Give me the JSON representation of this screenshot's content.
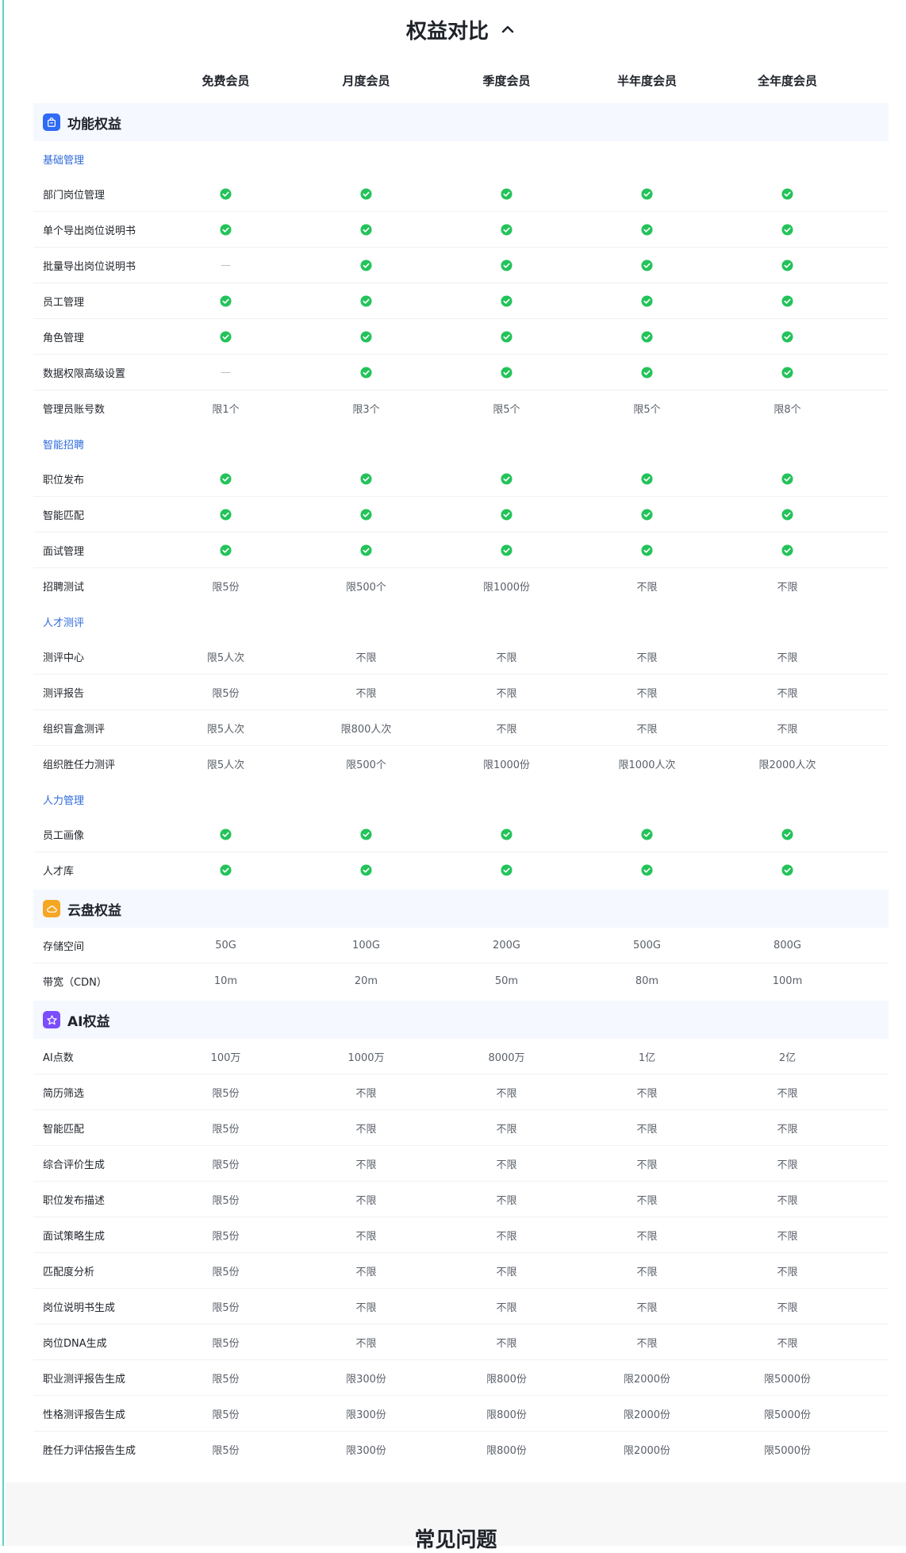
{
  "title": "权益对比",
  "columns": [
    "免费会员",
    "月度会员",
    "季度会员",
    "半年度会员",
    "全年度会员"
  ],
  "colors": {
    "check": "#23c35a",
    "subcat": "#2f6bdc",
    "section_bg": "#f5f8ff"
  },
  "sections": [
    {
      "title": "功能权益",
      "icon": "bag-icon",
      "icon_color": "#2f6bf5",
      "groups": [
        {
          "name": "基础管理",
          "rows": [
            {
              "label": "部门岗位管理",
              "values": [
                "check",
                "check",
                "check",
                "check",
                "check"
              ]
            },
            {
              "label": "单个导出岗位说明书",
              "values": [
                "check",
                "check",
                "check",
                "check",
                "check"
              ]
            },
            {
              "label": "批量导出岗位说明书",
              "values": [
                "dash",
                "check",
                "check",
                "check",
                "check"
              ]
            },
            {
              "label": "员工管理",
              "values": [
                "check",
                "check",
                "check",
                "check",
                "check"
              ]
            },
            {
              "label": "角色管理",
              "values": [
                "check",
                "check",
                "check",
                "check",
                "check"
              ]
            },
            {
              "label": "数据权限高级设置",
              "values": [
                "dash",
                "check",
                "check",
                "check",
                "check"
              ]
            },
            {
              "label": "管理员账号数",
              "values": [
                "限1个",
                "限3个",
                "限5个",
                "限5个",
                "限8个"
              ]
            }
          ]
        },
        {
          "name": "智能招聘",
          "rows": [
            {
              "label": "职位发布",
              "values": [
                "check",
                "check",
                "check",
                "check",
                "check"
              ]
            },
            {
              "label": "智能匹配",
              "values": [
                "check",
                "check",
                "check",
                "check",
                "check"
              ]
            },
            {
              "label": "面试管理",
              "values": [
                "check",
                "check",
                "check",
                "check",
                "check"
              ]
            },
            {
              "label": "招聘测试",
              "values": [
                "限5份",
                "限500个",
                "限1000份",
                "不限",
                "不限"
              ]
            }
          ]
        },
        {
          "name": "人才测评",
          "rows": [
            {
              "label": "测评中心",
              "values": [
                "限5人次",
                "不限",
                "不限",
                "不限",
                "不限"
              ]
            },
            {
              "label": "测评报告",
              "values": [
                "限5份",
                "不限",
                "不限",
                "不限",
                "不限"
              ]
            },
            {
              "label": "组织盲盒测评",
              "values": [
                "限5人次",
                "限800人次",
                "不限",
                "不限",
                "不限"
              ]
            },
            {
              "label": "组织胜任力测评",
              "values": [
                "限5人次",
                "限500个",
                "限1000份",
                "限1000人次",
                "限2000人次"
              ]
            }
          ]
        },
        {
          "name": "人力管理",
          "rows": [
            {
              "label": "员工画像",
              "values": [
                "check",
                "check",
                "check",
                "check",
                "check"
              ]
            },
            {
              "label": "人才库",
              "values": [
                "check",
                "check",
                "check",
                "check",
                "check"
              ]
            }
          ]
        }
      ]
    },
    {
      "title": "云盘权益",
      "icon": "cloud-icon",
      "icon_color": "#f5a623",
      "groups": [
        {
          "name": "",
          "rows": [
            {
              "label": "存储空间",
              "values": [
                "50G",
                "100G",
                "200G",
                "500G",
                "800G"
              ]
            },
            {
              "label": "带宽（CDN）",
              "values": [
                "10m",
                "20m",
                "50m",
                "80m",
                "100m"
              ]
            }
          ]
        }
      ]
    },
    {
      "title": "AI权益",
      "icon": "ai-star-icon",
      "icon_color": "#7b4dff",
      "groups": [
        {
          "name": "",
          "rows": [
            {
              "label": "AI点数",
              "values": [
                "100万",
                "1000万",
                "8000万",
                "1亿",
                "2亿"
              ]
            },
            {
              "label": "简历筛选",
              "values": [
                "限5份",
                "不限",
                "不限",
                "不限",
                "不限"
              ]
            },
            {
              "label": "智能匹配",
              "values": [
                "限5份",
                "不限",
                "不限",
                "不限",
                "不限"
              ]
            },
            {
              "label": "综合评价生成",
              "values": [
                "限5份",
                "不限",
                "不限",
                "不限",
                "不限"
              ]
            },
            {
              "label": "职位发布描述",
              "values": [
                "限5份",
                "不限",
                "不限",
                "不限",
                "不限"
              ]
            },
            {
              "label": "面试策略生成",
              "values": [
                "限5份",
                "不限",
                "不限",
                "不限",
                "不限"
              ]
            },
            {
              "label": "匹配度分析",
              "values": [
                "限5份",
                "不限",
                "不限",
                "不限",
                "不限"
              ]
            },
            {
              "label": "岗位说明书生成",
              "values": [
                "限5份",
                "不限",
                "不限",
                "不限",
                "不限"
              ]
            },
            {
              "label": "岗位DNA生成",
              "values": [
                "限5份",
                "不限",
                "不限",
                "不限",
                "不限"
              ]
            },
            {
              "label": "职业测评报告生成",
              "values": [
                "限5份",
                "限300份",
                "限800份",
                "限2000份",
                "限5000份"
              ]
            },
            {
              "label": "性格测评报告生成",
              "values": [
                "限5份",
                "限300份",
                "限800份",
                "限2000份",
                "限5000份"
              ]
            },
            {
              "label": "胜任力评估报告生成",
              "values": [
                "限5份",
                "限300份",
                "限800份",
                "限2000份",
                "限5000份"
              ]
            }
          ]
        }
      ]
    }
  ],
  "faq_title": "常见问题"
}
